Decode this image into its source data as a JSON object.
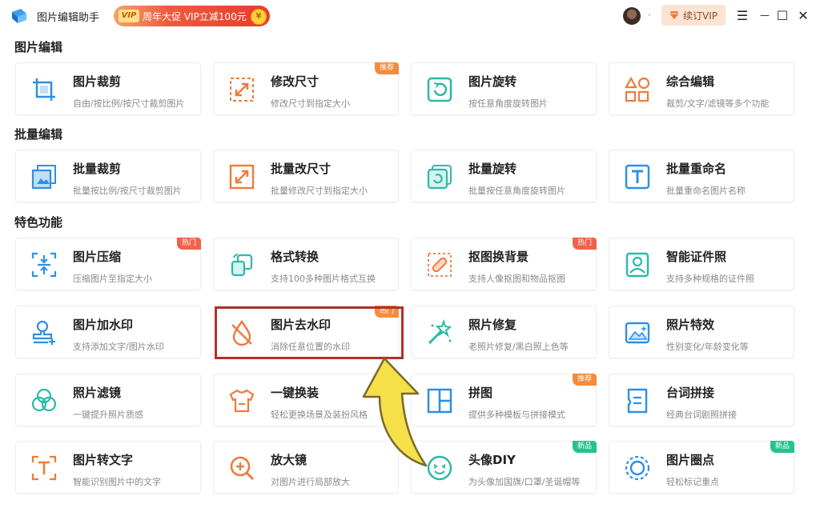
{
  "app": {
    "title": "图片编辑助手",
    "promo": {
      "vip_tag": "VIP",
      "text": "周年大促 VIP立减100元",
      "coin": "¥"
    },
    "dot": "·",
    "vip_button": "续订VIP",
    "window_controls": {
      "menu": "☰",
      "minimize": "—",
      "maximize": "☐",
      "close": "✕"
    }
  },
  "colors": {
    "accent_blue": "#2f8fe6",
    "accent_orange": "#f07a3a",
    "accent_teal": "#2cb9a8",
    "highlight_red": "#b0312b"
  },
  "sections": [
    {
      "title": "图片编辑",
      "cards": [
        {
          "title": "图片裁剪",
          "desc": "自由/按比例/按尺寸裁剪图片",
          "icon": "crop-icon",
          "badge": ""
        },
        {
          "title": "修改尺寸",
          "desc": "修改尺寸到指定大小",
          "icon": "resize-icon",
          "badge": "推荐"
        },
        {
          "title": "图片旋转",
          "desc": "按任意角度旋转图片",
          "icon": "rotate-icon",
          "badge": ""
        },
        {
          "title": "综合编辑",
          "desc": "裁剪/文字/滤镜等多个功能",
          "icon": "shapes-icon",
          "badge": ""
        }
      ]
    },
    {
      "title": "批量编辑",
      "cards": [
        {
          "title": "批量裁剪",
          "desc": "批量按比例/按尺寸裁剪图片",
          "icon": "batch-crop-icon",
          "badge": ""
        },
        {
          "title": "批量改尺寸",
          "desc": "批量修改尺寸到指定大小",
          "icon": "batch-resize-icon",
          "badge": ""
        },
        {
          "title": "批量旋转",
          "desc": "批量按任意角度旋转图片",
          "icon": "batch-rotate-icon",
          "badge": ""
        },
        {
          "title": "批量重命名",
          "desc": "批量重命名图片名称",
          "icon": "rename-icon",
          "badge": ""
        }
      ]
    },
    {
      "title": "特色功能",
      "cards": [
        {
          "title": "图片压缩",
          "desc": "压缩图片至指定大小",
          "icon": "compress-icon",
          "badge": "热门"
        },
        {
          "title": "格式转换",
          "desc": "支持100多种图片格式互换",
          "icon": "convert-icon",
          "badge": ""
        },
        {
          "title": "抠图换背景",
          "desc": "支持人像抠图和物品抠图",
          "icon": "cutout-icon",
          "badge": "热门"
        },
        {
          "title": "智能证件照",
          "desc": "支持多种规格的证件照",
          "icon": "id-photo-icon",
          "badge": ""
        },
        {
          "title": "图片加水印",
          "desc": "支持添加文字/图片水印",
          "icon": "stamp-icon",
          "badge": ""
        },
        {
          "title": "图片去水印",
          "desc": "消除任意位置的水印",
          "icon": "remove-watermark-icon",
          "badge": "热门"
        },
        {
          "title": "照片修复",
          "desc": "老照片修复/黑白照上色等",
          "icon": "magic-wand-icon",
          "badge": ""
        },
        {
          "title": "照片特效",
          "desc": "性别变化/年龄变化等",
          "icon": "photo-effect-icon",
          "badge": ""
        },
        {
          "title": "照片滤镜",
          "desc": "一键提升照片质感",
          "icon": "filter-icon",
          "badge": ""
        },
        {
          "title": "一键换装",
          "desc": "轻松更换场景及装扮风格",
          "icon": "shirt-icon",
          "badge": ""
        },
        {
          "title": "拼图",
          "desc": "提供多种模板与拼接模式",
          "icon": "collage-icon",
          "badge": "推荐"
        },
        {
          "title": "台词拼接",
          "desc": "经典台词剧照拼接",
          "icon": "subtitle-icon",
          "badge": ""
        },
        {
          "title": "图片转文字",
          "desc": "智能识别图片中的文字",
          "icon": "ocr-icon",
          "badge": ""
        },
        {
          "title": "放大镜",
          "desc": "对图片进行局部放大",
          "icon": "magnifier-icon",
          "badge": ""
        },
        {
          "title": "头像DIY",
          "desc": "为头像加国旗/口罩/圣诞帽等",
          "icon": "smiley-icon",
          "badge": "新品"
        },
        {
          "title": "图片圈点",
          "desc": "轻松标记重点",
          "icon": "circle-mark-icon",
          "badge": "新品"
        }
      ]
    }
  ]
}
